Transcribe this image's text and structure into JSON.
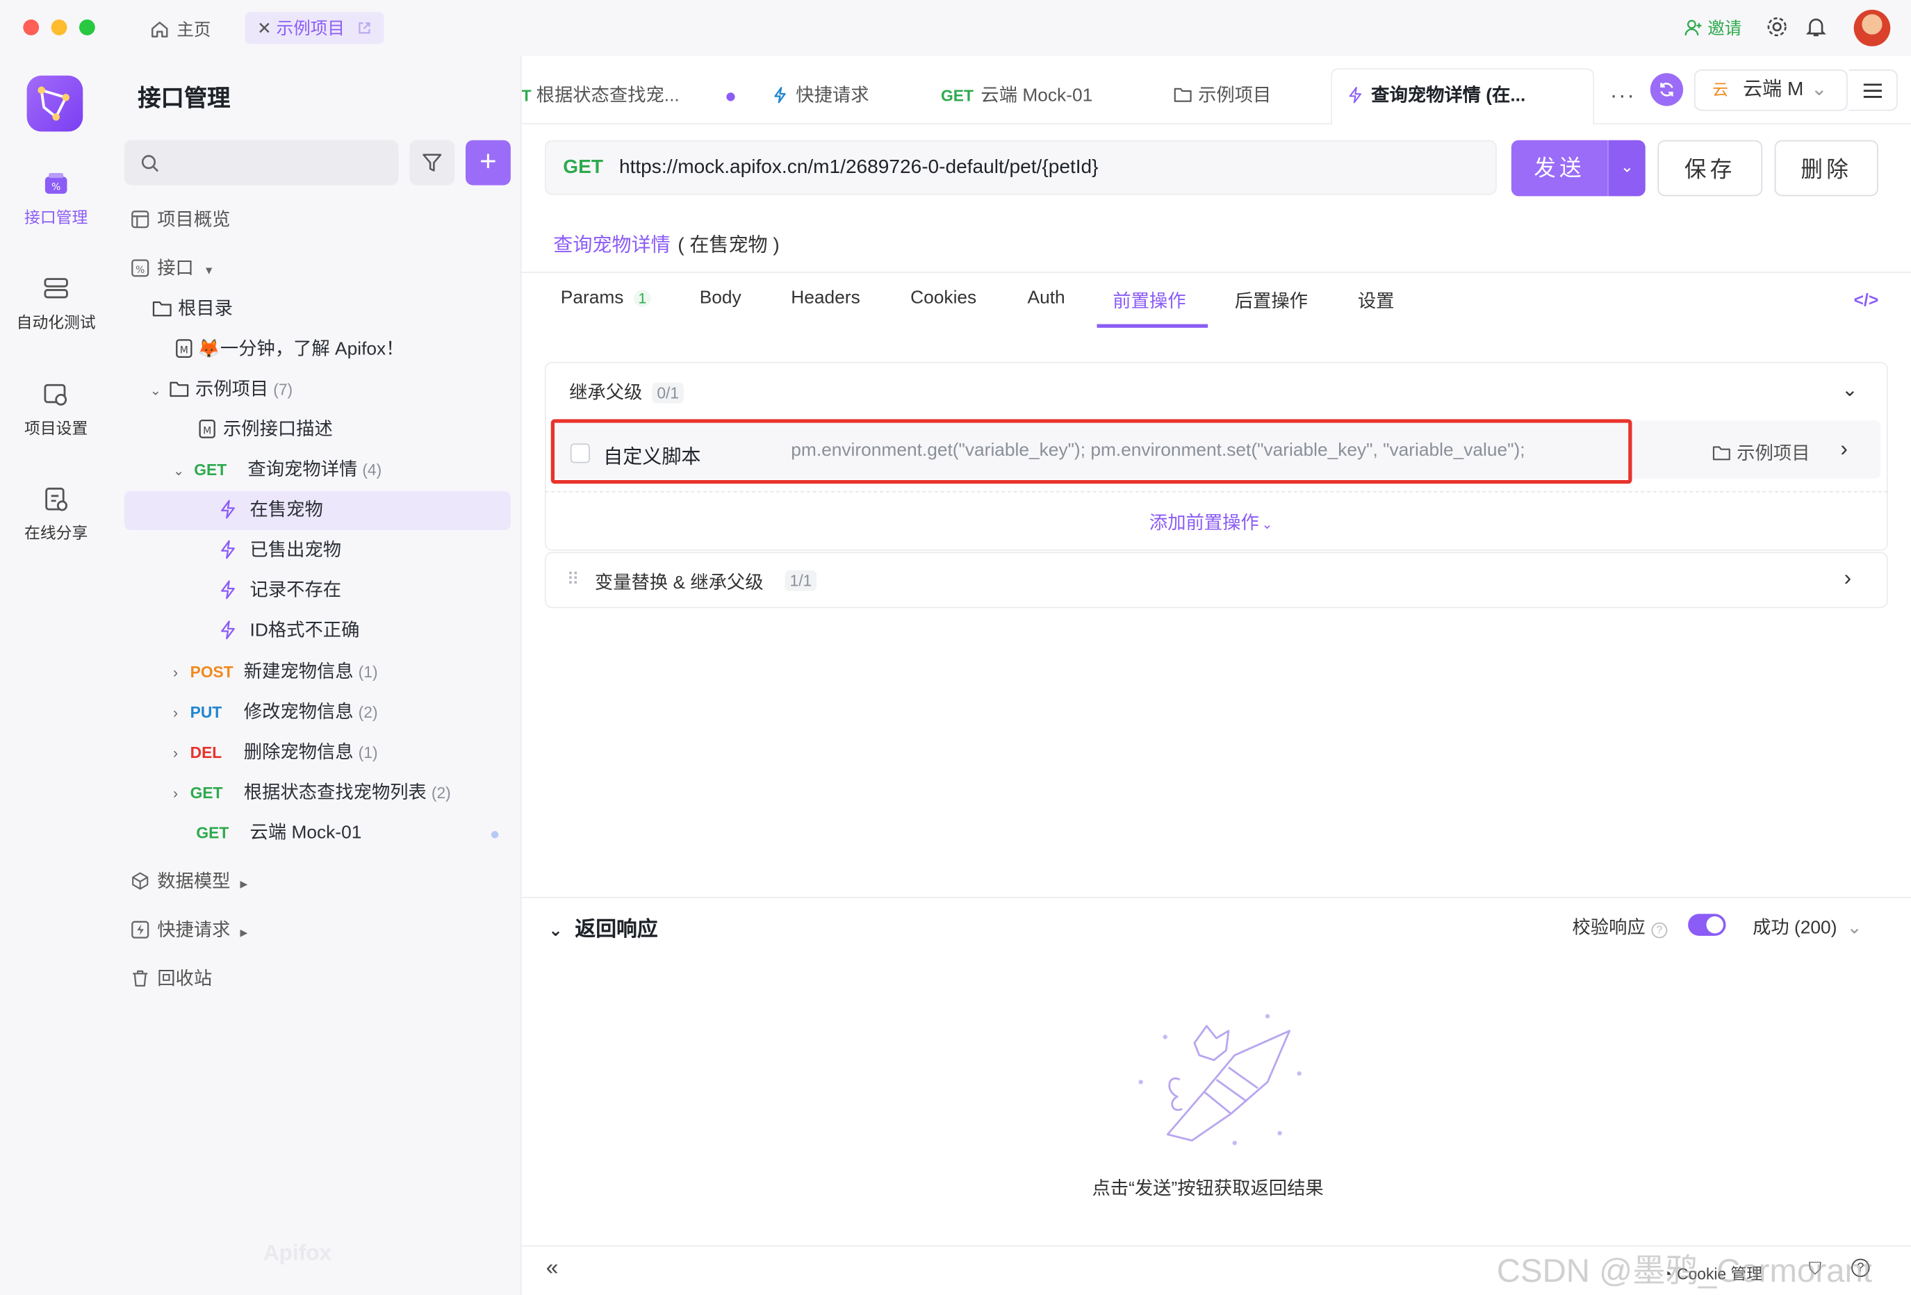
{
  "window": {
    "home_tab": "主页",
    "project_tab": "示例项目",
    "invite": "邀请"
  },
  "rail": {
    "items": [
      "接口管理",
      "自动化测试",
      "项目设置",
      "在线分享"
    ]
  },
  "sidebar": {
    "title": "接口管理",
    "overview": "项目概览",
    "api": "接口",
    "root": "根目录",
    "doc": "🦊一分钟，了解 Apifox！",
    "folder": "示例项目",
    "folder_count": "(7)",
    "folder_desc": "示例接口描述",
    "ep1": {
      "method": "GET",
      "name": "查询宠物详情",
      "count": "(4)"
    },
    "cases": [
      "在售宠物",
      "已售出宠物",
      "记录不存在",
      "ID格式不正确"
    ],
    "ep2": {
      "method": "POST",
      "name": "新建宠物信息",
      "count": "(1)"
    },
    "ep3": {
      "method": "PUT",
      "name": "修改宠物信息",
      "count": "(2)"
    },
    "ep4": {
      "method": "DEL",
      "name": "删除宠物信息",
      "count": "(1)"
    },
    "ep5": {
      "method": "GET",
      "name": "根据状态查找宠物列表",
      "count": "(2)"
    },
    "ep6": {
      "method": "GET",
      "name": "云端 Mock-01"
    },
    "models": "数据模型",
    "quick": "快捷请求",
    "trash": "回收站",
    "brand": "Apifox"
  },
  "tabs": {
    "t1": "根据状态查找宠...",
    "t2": "快捷请求",
    "t3_method": "GET",
    "t3": "云端 Mock-01",
    "t4": "示例项目",
    "t5": "查询宠物详情 (在...",
    "env_icon": "云",
    "env": "云端 M"
  },
  "request": {
    "method": "GET",
    "url": "https://mock.apifox.cn/m1/2689726-0-default/pet/{petId}",
    "send": "发送",
    "save": "保存",
    "delete": "删除",
    "name_link": "查询宠物详情",
    "name_suffix": "( 在售宠物 )"
  },
  "subtabs": {
    "params": "Params",
    "params_count": "1",
    "body": "Body",
    "headers": "Headers",
    "cookies": "Cookies",
    "auth": "Auth",
    "pre": "前置操作",
    "post": "后置操作",
    "settings": "设置"
  },
  "pre": {
    "inherit": "继承父级",
    "inherit_count": "0/1",
    "script_label": "自定义脚本",
    "script_code": "pm.environment.get(\"variable_key\"); pm.environment.set(\"variable_key\", \"variable_value\");",
    "script_source": "示例项目",
    "add": "添加前置操作",
    "var": "变量替换 & 继承父级",
    "var_count": "1/1"
  },
  "response": {
    "title": "返回响应",
    "validate": "校验响应",
    "status": "成功 (200)",
    "empty": "点击“发送”按钮获取返回结果"
  },
  "footer": {
    "cookie": "Cookie 管理",
    "watermark": "CSDN @墨鸦_Cormorant"
  },
  "colors": {
    "accent": "#8b5cf6",
    "highlight": "#e8332c"
  }
}
